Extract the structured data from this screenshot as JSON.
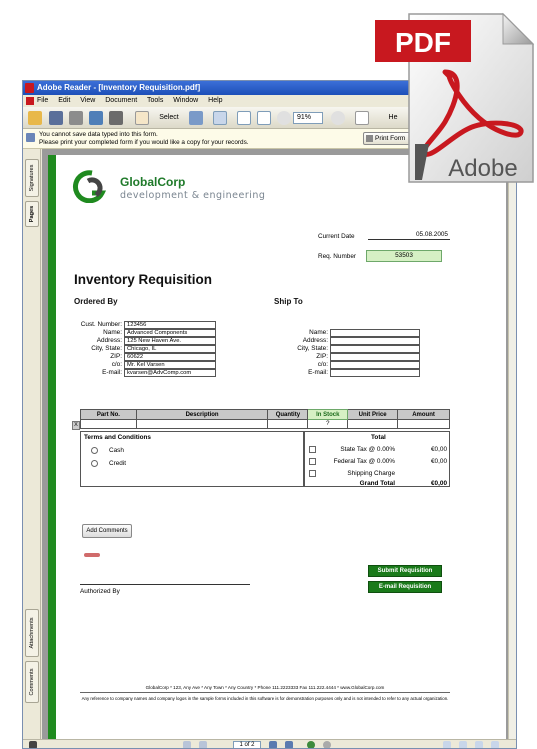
{
  "window": {
    "title": "Adobe Reader - [Inventory Requisition.pdf]",
    "menu": [
      "File",
      "Edit",
      "View",
      "Document",
      "Tools",
      "Window",
      "Help"
    ],
    "toolbar": {
      "select_label": "Select",
      "zoom": "91%",
      "help_label": "He"
    },
    "notice": {
      "line1": "You cannot save data typed into this form.",
      "line2": "Please print your completed form if you would like a copy for your records.",
      "print_button": "Print Form"
    },
    "nav_tabs": [
      "Signatures",
      "Pages",
      "Attachments",
      "Comments"
    ],
    "status": {
      "page_indicator": "1 of 2"
    }
  },
  "pdf_icon": {
    "badge": "PDF",
    "brand": "Adobe"
  },
  "doc": {
    "brand_name": "GlobalCorp",
    "brand_tagline": "development & engineering",
    "current_date_label": "Current Date",
    "current_date_value": "05.08.2005",
    "req_number_label": "Req. Number",
    "req_number_value": "53503",
    "title": "Inventory Requisition",
    "ordered_by": "Ordered By",
    "ship_to": "Ship To",
    "ordered_fields": [
      {
        "label": "Cust. Number:",
        "value": "123456"
      },
      {
        "label": "Name:",
        "value": "Advanced Components"
      },
      {
        "label": "Address:",
        "value": "125 New Haven Ave."
      },
      {
        "label": "City, State:",
        "value": "Chicago, IL"
      },
      {
        "label": "ZIP:",
        "value": "60622"
      },
      {
        "label": "c/o:",
        "value": "Mr. Kel Varsen"
      },
      {
        "label": "E-mail:",
        "value": "kvarsen@AdvComp.com"
      }
    ],
    "ship_fields": [
      {
        "label": "Name:",
        "value": ""
      },
      {
        "label": "Address:",
        "value": ""
      },
      {
        "label": "City, State:",
        "value": ""
      },
      {
        "label": "ZIP:",
        "value": ""
      },
      {
        "label": "c/o:",
        "value": ""
      },
      {
        "label": "E-mail:",
        "value": ""
      }
    ],
    "table_headers": [
      "Part No.",
      "Description",
      "Quantity",
      "In Stock",
      "Unit Price",
      "Amount"
    ],
    "row_instock": "?",
    "row_marker": "X",
    "terms_title": "Terms and Conditions",
    "terms_options": [
      "Cash",
      "Credit"
    ],
    "total_label": "Total",
    "totals": [
      {
        "label": "State Tax @ 0.00%",
        "value": "€0,00"
      },
      {
        "label": "Federal Tax @ 0.00%",
        "value": "€0,00"
      },
      {
        "label": "Shipping Charge",
        "value": ""
      }
    ],
    "grand_total_label": "Grand Total",
    "grand_total_value": "€0,00",
    "add_comments": "Add Comments",
    "submit": "Submit Requisition",
    "email": "E-mail Requisition",
    "authorized_by": "Authorized By",
    "footer_line1": "GlobalCorp * 123, Any Ave * Any Town * Any Country * Phone 111.2223333 Fax 111.222.4444 * www.GlobalCorp.com",
    "footer_line2": "Any reference to company names and company logos in the sample forms included in this software is for demonstration purposes only and is not intended to refer to any actual organization."
  },
  "colors": {
    "accent_green": "#1f8a1f",
    "pdf_red": "#c8181f"
  }
}
